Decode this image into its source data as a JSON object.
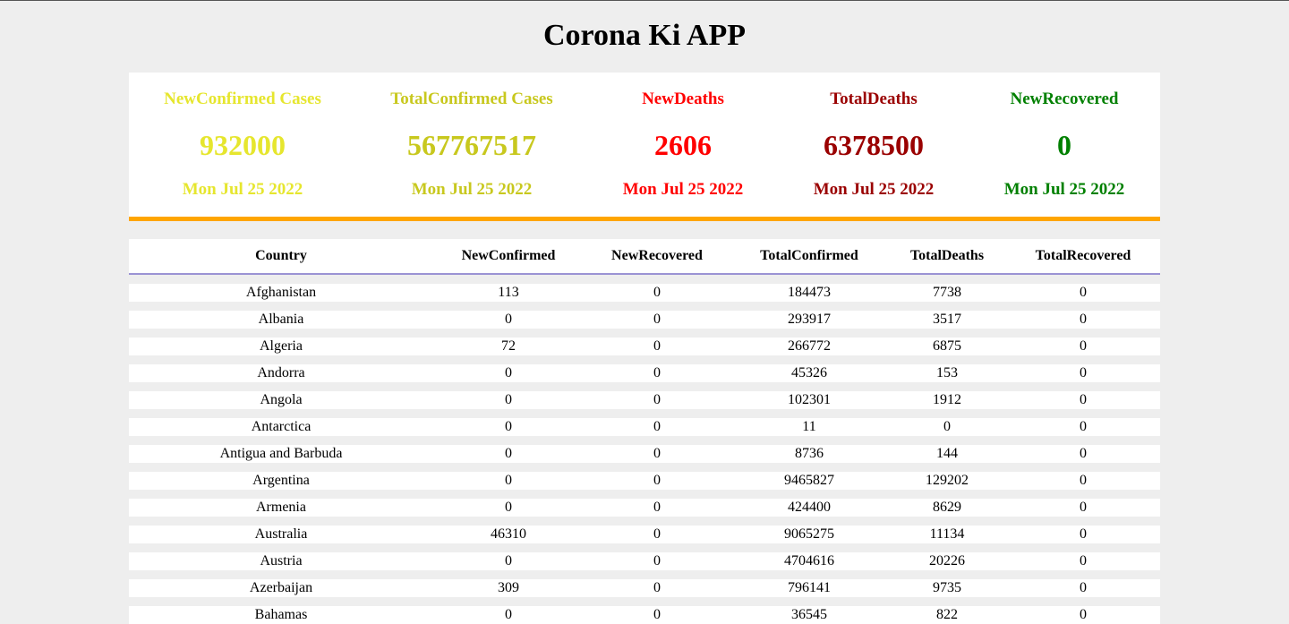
{
  "app": {
    "title": "Corona Ki APP"
  },
  "stats": [
    {
      "label": "NewConfirmed Cases",
      "value": "932000",
      "date": "Mon Jul 25 2022",
      "color": "#e6e62e"
    },
    {
      "label": "TotalConfirmed Cases",
      "value": "567767517",
      "date": "Mon Jul 25 2022",
      "color": "#c8c81e"
    },
    {
      "label": "NewDeaths",
      "value": "2606",
      "date": "Mon Jul 25 2022",
      "color": "#ff0000"
    },
    {
      "label": "TotalDeaths",
      "value": "6378500",
      "date": "Mon Jul 25 2022",
      "color": "#9a0000"
    },
    {
      "label": "NewRecovered",
      "value": "0",
      "date": "Mon Jul 25 2022",
      "color": "#008000"
    }
  ],
  "stats_card_border_color": "#ffa500",
  "table": {
    "headers": [
      "Country",
      "NewConfirmed",
      "NewRecovered",
      "TotalConfirmed",
      "TotalDeaths",
      "TotalRecovered"
    ],
    "rows": [
      [
        "Afghanistan",
        "113",
        "0",
        "184473",
        "7738",
        "0"
      ],
      [
        "Albania",
        "0",
        "0",
        "293917",
        "3517",
        "0"
      ],
      [
        "Algeria",
        "72",
        "0",
        "266772",
        "6875",
        "0"
      ],
      [
        "Andorra",
        "0",
        "0",
        "45326",
        "153",
        "0"
      ],
      [
        "Angola",
        "0",
        "0",
        "102301",
        "1912",
        "0"
      ],
      [
        "Antarctica",
        "0",
        "0",
        "11",
        "0",
        "0"
      ],
      [
        "Antigua and Barbuda",
        "0",
        "0",
        "8736",
        "144",
        "0"
      ],
      [
        "Argentina",
        "0",
        "0",
        "9465827",
        "129202",
        "0"
      ],
      [
        "Armenia",
        "0",
        "0",
        "424400",
        "8629",
        "0"
      ],
      [
        "Australia",
        "46310",
        "0",
        "9065275",
        "11134",
        "0"
      ],
      [
        "Austria",
        "0",
        "0",
        "4704616",
        "20226",
        "0"
      ],
      [
        "Azerbaijan",
        "309",
        "0",
        "796141",
        "9735",
        "0"
      ],
      [
        "Bahamas",
        "0",
        "0",
        "36545",
        "822",
        "0"
      ]
    ]
  }
}
